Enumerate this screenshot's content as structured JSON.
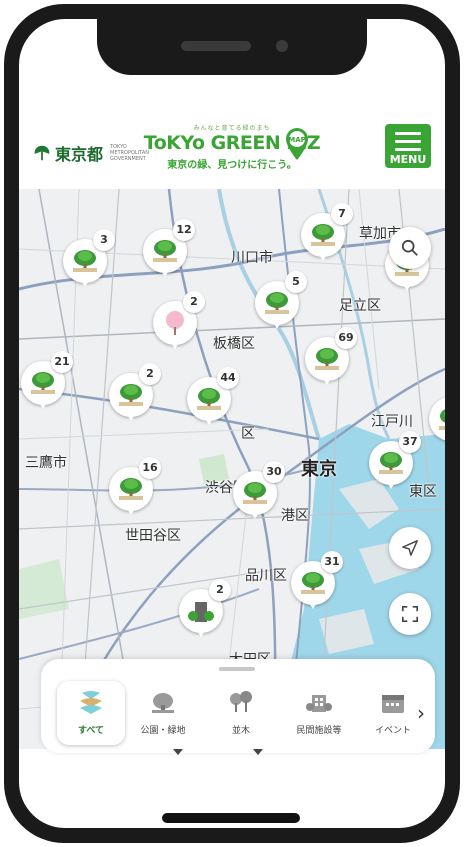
{
  "header": {
    "tokyo_logo": "東京都",
    "tokyo_logo_sub": "TOKYO METROPOLITAN GOVERNMENT",
    "brand_tagline": "みんなと育てる緑のまち",
    "brand_name": "ToKYo GREEN BIZ",
    "brand_badge": "MAP",
    "brand_sub": "東京の緑、見つけに行こう。",
    "menu_label": "MENU",
    "accent": "#3aa535"
  },
  "map": {
    "places": {
      "kawaguchi": "川口市",
      "soka": "草加市",
      "itabashi": "板橋区",
      "adachi": "足立区",
      "mitaka": "三鷹市",
      "tokyo": "東京",
      "edogawa": "江戸川",
      "koto": "東区",
      "shibuya": "渋谷区",
      "minato": "港区",
      "setagaya": "世田谷区",
      "shinagawa": "品川区",
      "ota": "大田区",
      "ku_fragment": "区"
    },
    "markers": [
      {
        "count": "3",
        "type": "park"
      },
      {
        "count": "12",
        "type": "park"
      },
      {
        "count": "7",
        "type": "park"
      },
      {
        "count": "5",
        "type": "park"
      },
      {
        "count": "2",
        "type": "sakura"
      },
      {
        "count": "69",
        "type": "park"
      },
      {
        "count": "21",
        "type": "park"
      },
      {
        "count": "2",
        "type": "park"
      },
      {
        "count": "44",
        "type": "park"
      },
      {
        "count": "37",
        "type": "park"
      },
      {
        "count": "16",
        "type": "park"
      },
      {
        "count": "30",
        "type": "park"
      },
      {
        "count": "31",
        "type": "park"
      },
      {
        "count": "2",
        "type": "building"
      },
      {
        "count": "",
        "type": "park"
      },
      {
        "count": "",
        "type": "park"
      }
    ],
    "buttons": {
      "search": "search-icon",
      "locate": "navigation-arrow-icon",
      "fullscreen": "fullscreen-icon"
    }
  },
  "categories": [
    {
      "label": "すべて",
      "icon": "all-icon",
      "active": true
    },
    {
      "label": "公園・緑地",
      "icon": "park-icon",
      "active": false
    },
    {
      "label": "並木",
      "icon": "tree-row-icon",
      "active": false
    },
    {
      "label": "民間施設等",
      "icon": "building-icon",
      "active": false
    },
    {
      "label": "イベント",
      "icon": "calendar-icon",
      "active": false
    }
  ]
}
